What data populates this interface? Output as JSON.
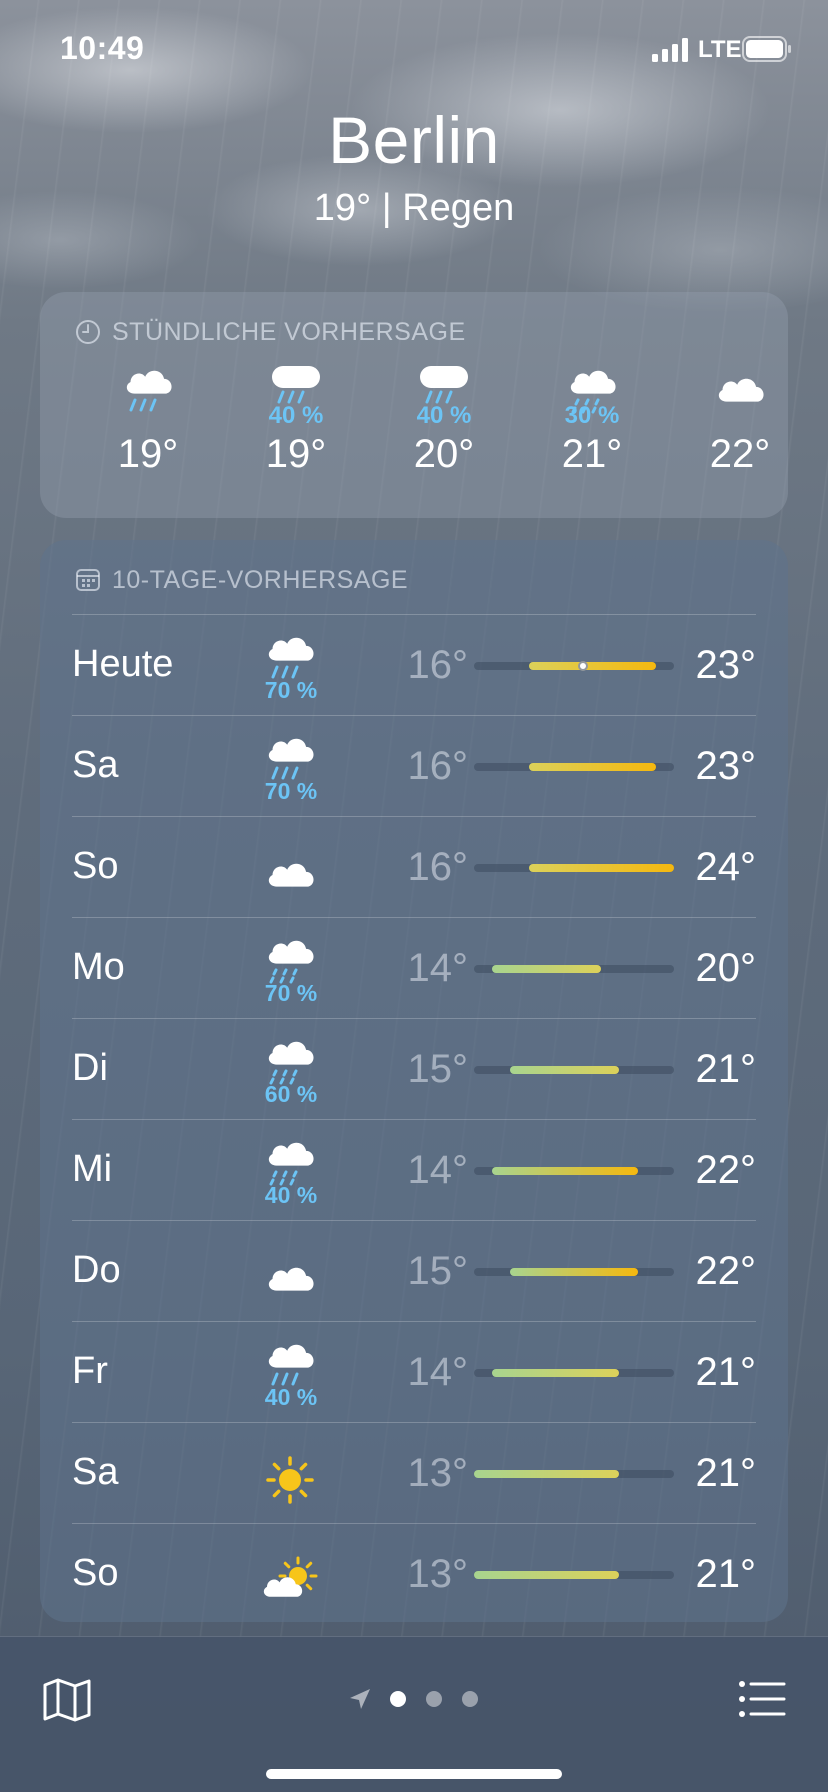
{
  "status_bar": {
    "time": "10:49",
    "network": "LTE"
  },
  "header": {
    "city": "Berlin",
    "summary": "19°  |  Regen"
  },
  "hourly": {
    "title": "STÜNDLICHE VORHERSAGE",
    "items": [
      {
        "icon": "cloud-rain-icon",
        "pct": "",
        "temp": "19°"
      },
      {
        "icon": "cloud-heavy-rain-icon",
        "pct": "40 %",
        "temp": "19°"
      },
      {
        "icon": "cloud-heavy-rain-icon",
        "pct": "40 %",
        "temp": "20°"
      },
      {
        "icon": "cloud-drizzle-icon",
        "pct": "30 %",
        "temp": "21°"
      },
      {
        "icon": "cloud-icon",
        "pct": "",
        "temp": "22°"
      }
    ]
  },
  "daily": {
    "title": "10-TAGE-VORHERSAGE",
    "range_min": 13,
    "range_max": 24,
    "current_temp": 19,
    "colors": {
      "cool": "#a8d48f",
      "mid": "#dcd15a",
      "warm": "#f5b80f"
    },
    "days": [
      {
        "day": "Heute",
        "icon": "cloud-rain-icon",
        "pct": "70 %",
        "low": "16°",
        "high": "23°",
        "low_val": 16,
        "high_val": 23,
        "now": true
      },
      {
        "day": "Sa",
        "icon": "cloud-rain-icon",
        "pct": "70 %",
        "low": "16°",
        "high": "23°",
        "low_val": 16,
        "high_val": 23
      },
      {
        "day": "So",
        "icon": "cloud-icon",
        "pct": "",
        "low": "16°",
        "high": "24°",
        "low_val": 16,
        "high_val": 24
      },
      {
        "day": "Mo",
        "icon": "cloud-drizzle-icon",
        "pct": "70 %",
        "low": "14°",
        "high": "20°",
        "low_val": 14,
        "high_val": 20
      },
      {
        "day": "Di",
        "icon": "cloud-drizzle-icon",
        "pct": "60 %",
        "low": "15°",
        "high": "21°",
        "low_val": 15,
        "high_val": 21
      },
      {
        "day": "Mi",
        "icon": "cloud-drizzle-icon",
        "pct": "40 %",
        "low": "14°",
        "high": "22°",
        "low_val": 14,
        "high_val": 22
      },
      {
        "day": "Do",
        "icon": "cloud-icon",
        "pct": "",
        "low": "15°",
        "high": "22°",
        "low_val": 15,
        "high_val": 22
      },
      {
        "day": "Fr",
        "icon": "cloud-rain-icon",
        "pct": "40 %",
        "low": "14°",
        "high": "21°",
        "low_val": 14,
        "high_val": 21
      },
      {
        "day": "Sa",
        "icon": "sun-icon",
        "pct": "",
        "low": "13°",
        "high": "21°",
        "low_val": 13,
        "high_val": 21
      },
      {
        "day": "So",
        "icon": "partly-sunny-icon",
        "pct": "",
        "low": "13°",
        "high": "21°",
        "low_val": 13,
        "high_val": 21
      }
    ]
  },
  "bottom_bar": {
    "pages": 3,
    "active_page": 0
  }
}
